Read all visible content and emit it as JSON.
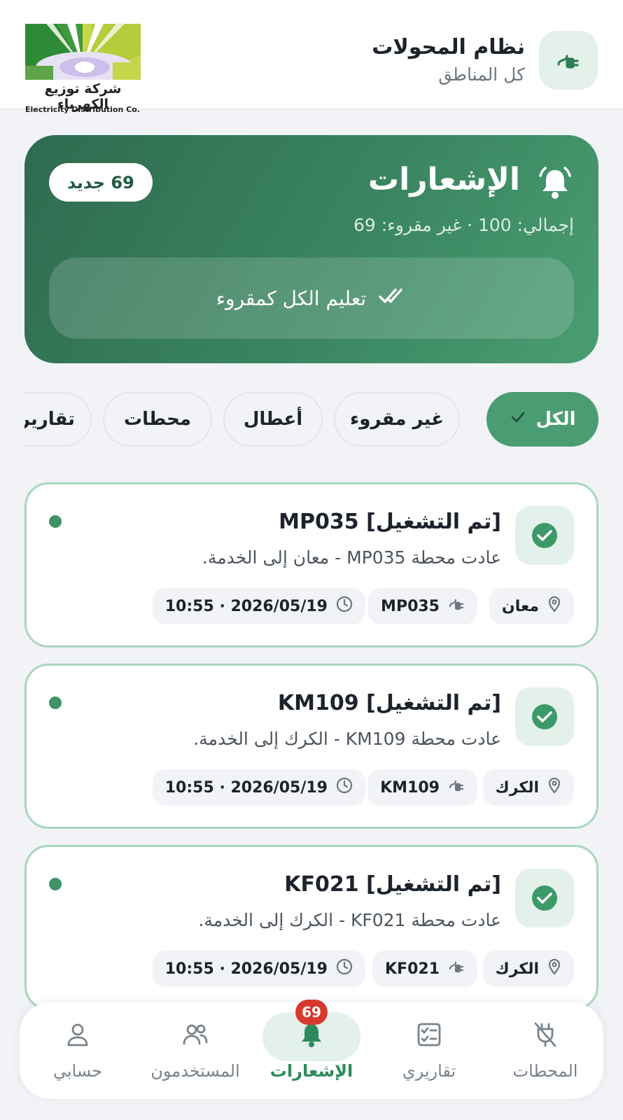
{
  "header": {
    "title": "نظام المحولات",
    "subtitle": "كل المناطق",
    "logo_ar": "شركة توزيع الكهرباء",
    "logo_en": "Electricity Distribution Co."
  },
  "hero": {
    "title": "الإشعارات",
    "stats": "إجمالي: 100 · غير مقروء: 69",
    "badge": "69 جديد",
    "mark_all_label": "تعليم الكل كمقروء"
  },
  "filters": {
    "items": [
      {
        "label": "الكل",
        "active": true
      },
      {
        "label": "غير مقروء",
        "active": false
      },
      {
        "label": "أعطال",
        "active": false
      },
      {
        "label": "محطات",
        "active": false
      },
      {
        "label": "تقارير",
        "active": false
      }
    ]
  },
  "notifications": [
    {
      "title": "[تم التشغيل] MP035",
      "body": "عادت محطة MP035 - معان إلى الخدمة.",
      "location": "معان",
      "station": "MP035",
      "datetime": "10:55 · 2026/05/19",
      "unread": true
    },
    {
      "title": "[تم التشغيل] KM109",
      "body": "عادت محطة KM109 - الكرك إلى الخدمة.",
      "location": "الكرك",
      "station": "KM109",
      "datetime": "10:55 · 2026/05/19",
      "unread": true
    },
    {
      "title": "[تم التشغيل] KF021",
      "body": "عادت محطة KF021 - الكرك إلى الخدمة.",
      "location": "الكرك",
      "station": "KF021",
      "datetime": "10:55 · 2026/05/19",
      "unread": true
    }
  ],
  "nav": {
    "items": [
      {
        "label": "المحطات",
        "icon": "plug-off-icon"
      },
      {
        "label": "تقاريري",
        "icon": "report-icon"
      },
      {
        "label": "الإشعارات",
        "icon": "bell-icon",
        "active": true,
        "badge": "69"
      },
      {
        "label": "المستخدمون",
        "icon": "users-icon"
      },
      {
        "label": "حسابي",
        "icon": "user-icon"
      }
    ]
  },
  "colors": {
    "primary": "#4a9d72",
    "primary_dark": "#2e6b50",
    "badge_red": "#d63a2f",
    "card_border": "#a7d7bd"
  }
}
